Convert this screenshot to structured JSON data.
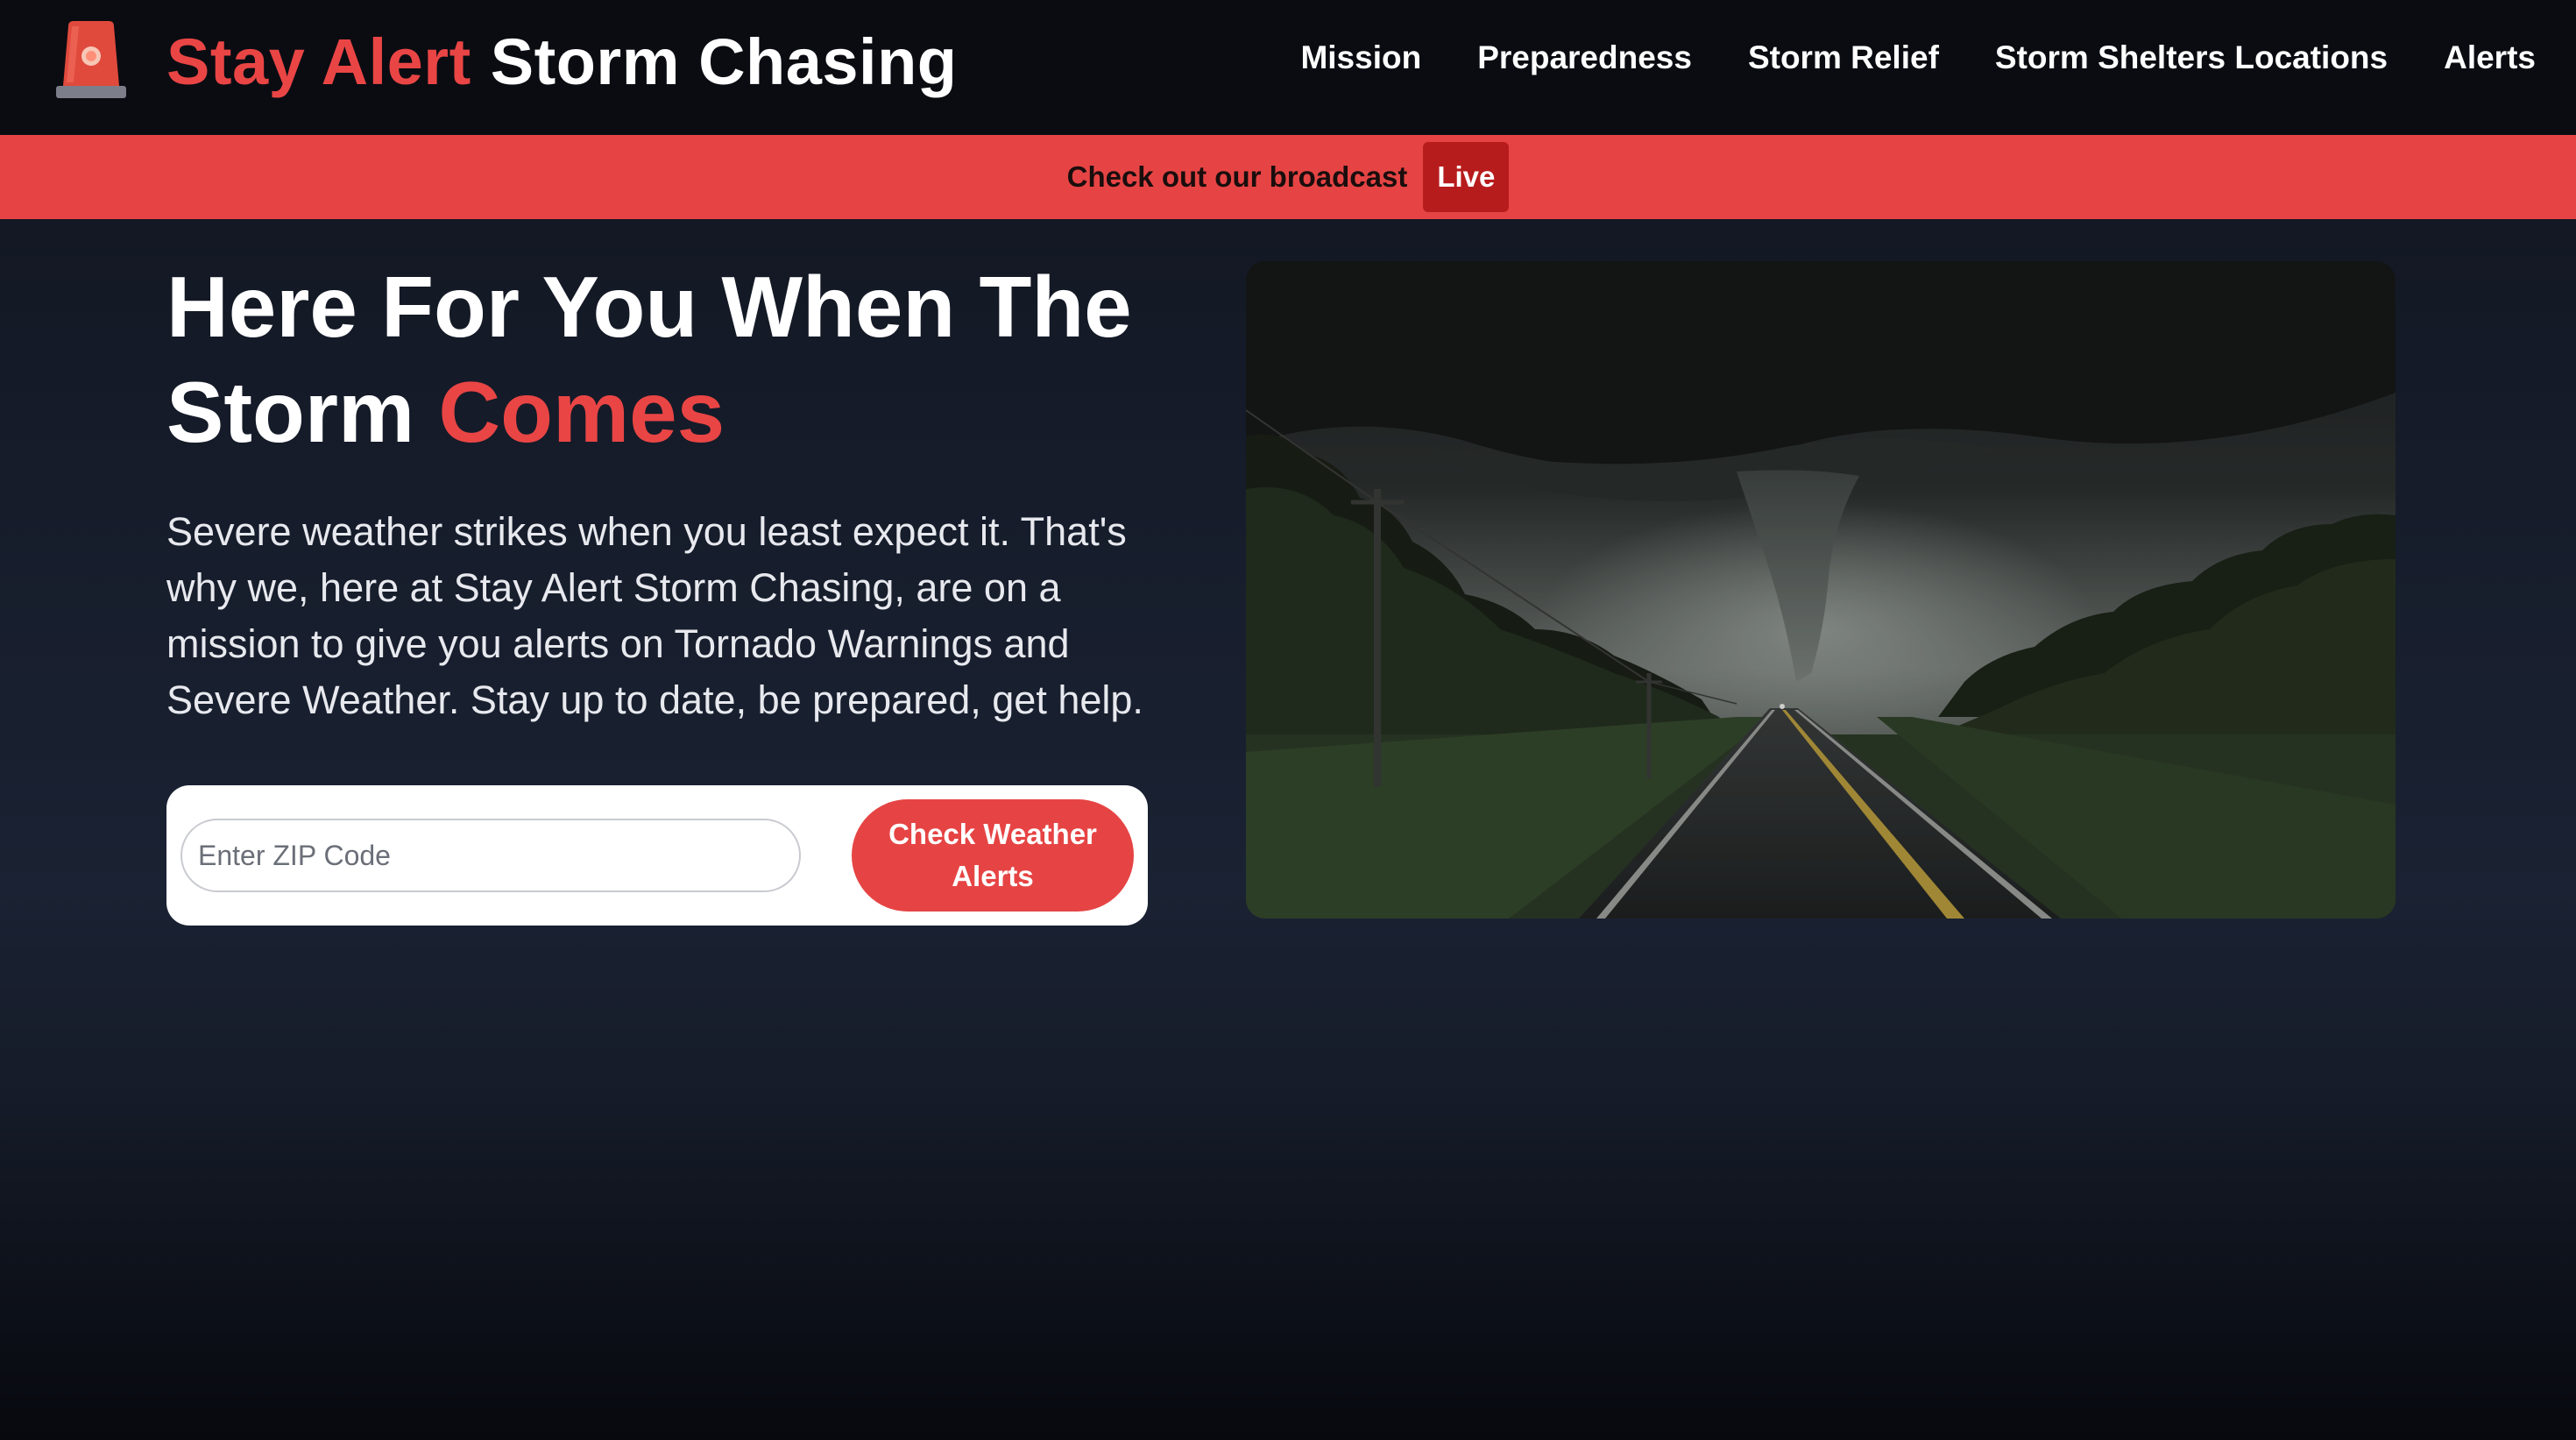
{
  "header": {
    "brand_accent": "Stay Alert",
    "brand_rest": "Storm Chasing",
    "logo_icon": "siren-icon",
    "nav": [
      {
        "label": "Mission"
      },
      {
        "label": "Preparedness"
      },
      {
        "label": "Storm Relief"
      },
      {
        "label": "Storm Shelters Locations"
      },
      {
        "label": "Alerts"
      }
    ]
  },
  "banner": {
    "text": "Check out our broadcast",
    "live_label": "Live"
  },
  "hero": {
    "headline_main": "Here For You When The Storm ",
    "headline_accent": "Comes",
    "lede": "Severe weather strikes when you least expect it. That's why we, here at Stay Alert Storm Chasing, are on a mission to give you alerts on Tornado Warnings and Severe Weather. Stay up to date, be prepared, get help.",
    "zip_placeholder": "Enter ZIP Code",
    "zip_value": "",
    "button_label": "Check Weather Alerts"
  },
  "colors": {
    "accent": "#e94545",
    "banner": "#e64444",
    "live_badge": "#b71c1c",
    "header_bg": "#0a0c12"
  }
}
